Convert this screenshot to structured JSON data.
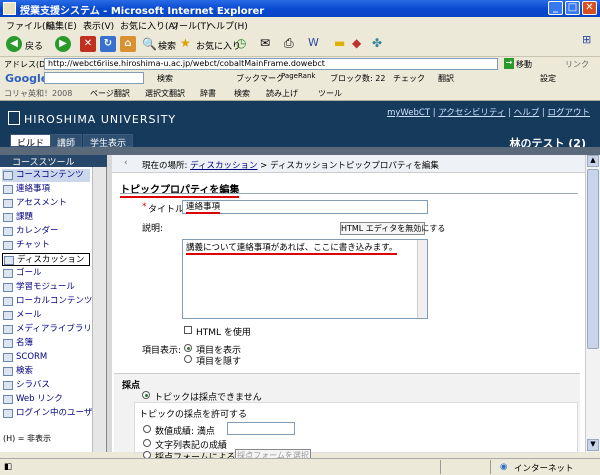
{
  "window": {
    "title": "授業支援システム - Microsoft Internet Explorer"
  },
  "menu": [
    "ファイル(F)",
    "編集(E)",
    "表示(V)",
    "お気に入り(A)",
    "ツール(T)",
    "ヘルプ(H)"
  ],
  "toolbar": {
    "back": "戻る",
    "search": "検索",
    "favorites": "お気に入り"
  },
  "address": {
    "label": "アドレス(D)",
    "url": "http://webct6riise.hiroshima-u.ac.jp/webct/cobaltMainFrame.dowebct",
    "go": "移動",
    "links": "リンク"
  },
  "google": {
    "logo": "Google",
    "search": "検索",
    "bookmarks": "ブックマーク",
    "pagerank": "PageRank",
    "blocked": "ブロック数: 22",
    "check": "チェック",
    "translate": "翻訳",
    "settings": "設定"
  },
  "linkbar": {
    "label": "コリャ英和！2008",
    "page_translate": "ページ翻訳",
    "select_translate": "選択文翻訳",
    "dict": "辞書",
    "search": "検索",
    "read": "読み上げ",
    "tools": "ツール"
  },
  "header": {
    "university": "HIROSHIMA UNIVERSITY",
    "links": [
      "myWebCT",
      "アクセシビリティ",
      "ヘルプ",
      "ログアウト"
    ],
    "course": "林のテスト (2)"
  },
  "tabs": [
    "ビルド",
    "講師",
    "学生表示"
  ],
  "sidebar": {
    "title": "コーススツール",
    "items": [
      "コースコンテンツ",
      "連絡事項",
      "アセスメント",
      "課題",
      "カレンダー",
      "チャット",
      "ディスカッション",
      "ゴール",
      "学習モジュール",
      "ローカルコンテンツ",
      "メール",
      "メディアライブラリ",
      "名簿",
      "SCORM",
      "検索",
      "シラバス",
      "Web リンク",
      "ログイン中のユーザ"
    ],
    "footer": "(H) = 非表示"
  },
  "main": {
    "breadcrumb_prefix": "現在の場所:",
    "breadcrumb_link": "ディスカッション",
    "breadcrumb_current": "ディスカッショントピックプロパティを編集",
    "page_title": "トピックプロパティを編集",
    "title_label": "タイトル:",
    "required_mark": "*",
    "title_value": "連絡事項",
    "desc_label": "説明:",
    "html_editor_button": "HTML エディタを無効にする",
    "desc_value": "講義について連絡事項があれば、ここに書き込みます。",
    "use_html_label": "HTML を使用",
    "display_label": "項目表示:",
    "display_show": "項目を表示",
    "display_hide": "項目を隠す",
    "grading_title": "採点",
    "grading_none": "トピックは採点できません",
    "grading_allow": "トピックの採点を許可する",
    "grading_numeric": "数値成績: 満点",
    "grading_text": "文字列表記の成績",
    "grading_form": "採点フォームによる採点:",
    "grading_form_button": "採点フォームを選択"
  },
  "status": {
    "zone": "インターネット"
  }
}
